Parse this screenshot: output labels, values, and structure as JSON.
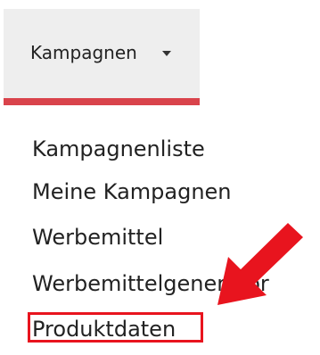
{
  "nav": {
    "tab_label": "Kampagnen",
    "caret_icon": "caret-down-icon",
    "accent_color": "#d9434b"
  },
  "menu": {
    "items": [
      {
        "label": "Kampagnenliste"
      },
      {
        "label": "Meine Kampagnen"
      },
      {
        "label": "Werbemittel"
      },
      {
        "label": "Werbemittelgenerator"
      },
      {
        "label": "Produktdaten"
      }
    ]
  },
  "annotation": {
    "highlight_color": "#e8141e",
    "arrow_icon": "red-arrow-icon",
    "highlighted_item": "Produktdaten"
  }
}
